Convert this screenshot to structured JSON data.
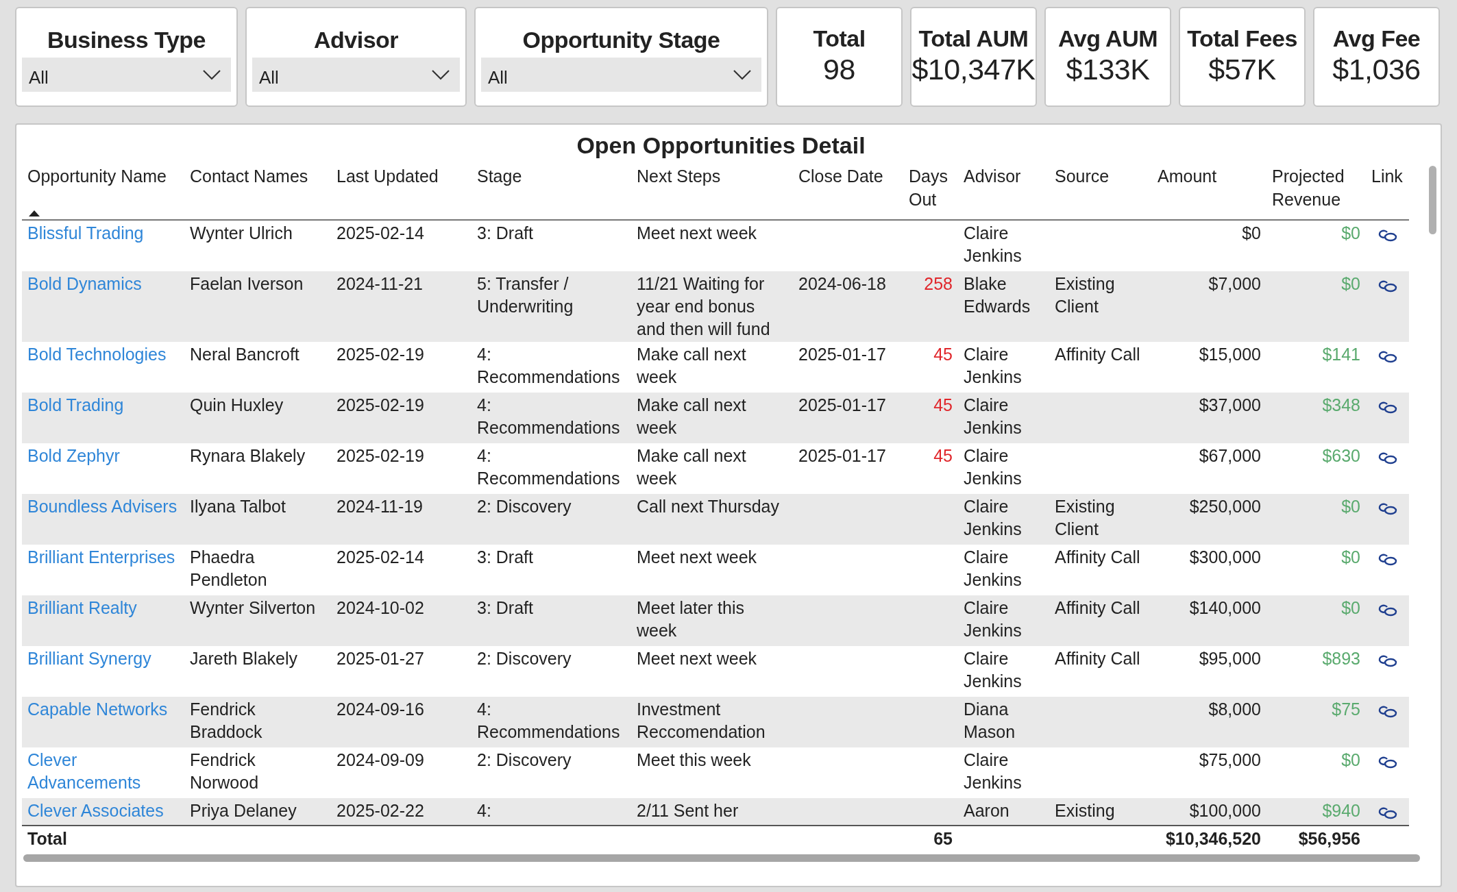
{
  "filters": [
    {
      "label": "Business Type",
      "value": "All"
    },
    {
      "label": "Advisor",
      "value": "All"
    },
    {
      "label": "Opportunity Stage",
      "value": "All"
    }
  ],
  "kpis": [
    {
      "label": "Total",
      "value": "98"
    },
    {
      "label": "Total AUM",
      "value": "$10,347K"
    },
    {
      "label": "Avg AUM",
      "value": "$133K"
    },
    {
      "label": "Total Fees",
      "value": "$57K"
    },
    {
      "label": "Avg Fee",
      "value": "$1,036"
    }
  ],
  "table": {
    "title": "Open Opportunities Detail",
    "columns": [
      {
        "label": "Opportunity Name",
        "sorted": true
      },
      {
        "label": "Contact Names",
        "sorted": false
      },
      {
        "label": "Last Updated",
        "sorted": false
      },
      {
        "label": "Stage",
        "sorted": false
      },
      {
        "label": "Next Steps",
        "sorted": false
      },
      {
        "label": "Close Date",
        "sorted": false
      },
      {
        "label": "Days Out",
        "sorted": false
      },
      {
        "label": "Advisor",
        "sorted": false
      },
      {
        "label": "Source",
        "sorted": false
      },
      {
        "label": "Amount",
        "sorted": false
      },
      {
        "label": "Projected Revenue",
        "sorted": false
      },
      {
        "label": "Link",
        "sorted": false
      }
    ],
    "rows": [
      {
        "opportunity": "Blissful Trading",
        "contact": "Wynter Ulrich",
        "last_updated": "2025-02-14",
        "stage": "3: Draft",
        "next_steps": "Meet next week",
        "close_date": "",
        "days_out": "",
        "advisor": "Claire Jenkins",
        "source": "",
        "amount": "$0",
        "projected_revenue": "$0"
      },
      {
        "opportunity": "Bold Dynamics",
        "contact": "Faelan Iverson",
        "last_updated": "2024-11-21",
        "stage": "5: Transfer / Underwriting",
        "next_steps": "11/21 Waiting for year end bonus and then will fund",
        "close_date": "2024-06-18",
        "days_out": "258",
        "advisor": "Blake Edwards",
        "source": "Existing Client",
        "amount": "$7,000",
        "projected_revenue": "$0"
      },
      {
        "opportunity": "Bold Technologies",
        "contact": "Neral Bancroft",
        "last_updated": "2025-02-19",
        "stage": "4: Recommendations",
        "next_steps": "Make call next week",
        "close_date": "2025-01-17",
        "days_out": "45",
        "advisor": "Claire Jenkins",
        "source": "Affinity Call",
        "amount": "$15,000",
        "projected_revenue": "$141"
      },
      {
        "opportunity": "Bold Trading",
        "contact": "Quin Huxley",
        "last_updated": "2025-02-19",
        "stage": "4: Recommendations",
        "next_steps": "Make call next week",
        "close_date": "2025-01-17",
        "days_out": "45",
        "advisor": "Claire Jenkins",
        "source": "",
        "amount": "$37,000",
        "projected_revenue": "$348"
      },
      {
        "opportunity": "Bold Zephyr",
        "contact": "Rynara Blakely",
        "last_updated": "2025-02-19",
        "stage": "4: Recommendations",
        "next_steps": "Make call next week",
        "close_date": "2025-01-17",
        "days_out": "45",
        "advisor": "Claire Jenkins",
        "source": "",
        "amount": "$67,000",
        "projected_revenue": "$630"
      },
      {
        "opportunity": "Boundless Advisers",
        "contact": "Ilyana Talbot",
        "last_updated": "2024-11-19",
        "stage": "2: Discovery",
        "next_steps": "Call next Thursday",
        "close_date": "",
        "days_out": "",
        "advisor": "Claire Jenkins",
        "source": "Existing Client",
        "amount": "$250,000",
        "projected_revenue": "$0"
      },
      {
        "opportunity": "Brilliant Enterprises",
        "contact": "Phaedra Pendleton",
        "last_updated": "2025-02-14",
        "stage": "3: Draft",
        "next_steps": "Meet next week",
        "close_date": "",
        "days_out": "",
        "advisor": "Claire Jenkins",
        "source": "Affinity Call",
        "amount": "$300,000",
        "projected_revenue": "$0"
      },
      {
        "opportunity": "Brilliant Realty",
        "contact": "Wynter Silverton",
        "last_updated": "2024-10-02",
        "stage": "3: Draft",
        "next_steps": "Meet later this week",
        "close_date": "",
        "days_out": "",
        "advisor": "Claire Jenkins",
        "source": "Affinity Call",
        "amount": "$140,000",
        "projected_revenue": "$0"
      },
      {
        "opportunity": "Brilliant Synergy",
        "contact": "Jareth Blakely",
        "last_updated": "2025-01-27",
        "stage": "2: Discovery",
        "next_steps": "Meet next week",
        "close_date": "",
        "days_out": "",
        "advisor": "Claire Jenkins",
        "source": "Affinity Call",
        "amount": "$95,000",
        "projected_revenue": "$893"
      },
      {
        "opportunity": "Capable Networks",
        "contact": "Fendrick Braddock",
        "last_updated": "2024-09-16",
        "stage": "4: Recommendations",
        "next_steps": "Investment Reccomendation",
        "close_date": "",
        "days_out": "",
        "advisor": "Diana Mason",
        "source": "",
        "amount": "$8,000",
        "projected_revenue": "$75"
      },
      {
        "opportunity": "Clever Advancements",
        "contact": "Fendrick Norwood",
        "last_updated": "2024-09-09",
        "stage": "2: Discovery",
        "next_steps": "Meet this week",
        "close_date": "",
        "days_out": "",
        "advisor": "Claire Jenkins",
        "source": "",
        "amount": "$75,000",
        "projected_revenue": "$0"
      },
      {
        "opportunity": "Clever Associates",
        "contact": "Priya Delaney",
        "last_updated": "2025-02-22",
        "stage": "4:",
        "next_steps": "2/11 Sent her",
        "close_date": "",
        "days_out": "",
        "advisor": "Aaron",
        "source": "Existing",
        "amount": "$100,000",
        "projected_revenue": "$940"
      }
    ],
    "total": {
      "label": "Total",
      "days_out": "65",
      "amount": "$10,346,520",
      "projected_revenue": "$56,956"
    }
  }
}
